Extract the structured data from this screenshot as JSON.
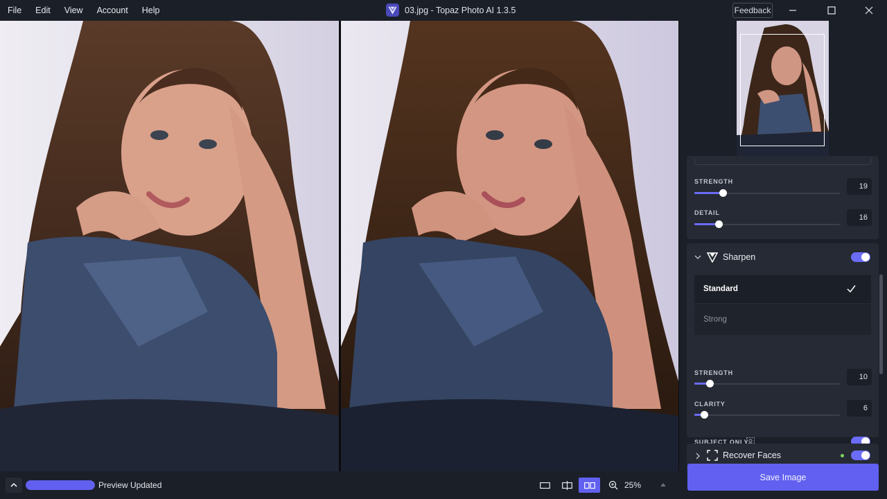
{
  "menu": [
    "File",
    "Edit",
    "View",
    "Account",
    "Help"
  ],
  "window_title": "03.jpg - Topaz Photo AI 1.3.5",
  "feedback_label": "Feedback",
  "denoise": {
    "strength_label": "STRENGTH",
    "strength_value": "19",
    "detail_label": "DETAIL",
    "detail_value": "16"
  },
  "sharpen": {
    "title": "Sharpen",
    "options": [
      "Standard",
      "Strong"
    ],
    "selected": "Standard",
    "strength_label": "STRENGTH",
    "strength_value": "10",
    "clarity_label": "CLARITY",
    "clarity_value": "6",
    "subject_only_label": "SUBJECT ONLY"
  },
  "recover_faces_title": "Recover Faces",
  "status": {
    "text": "Preview Updated",
    "progress": 1.0
  },
  "zoom": "25%",
  "save_label": "Save Image",
  "colors": {
    "accent": "#6160f0",
    "background": "#1b1f27",
    "card": "#252a34"
  }
}
